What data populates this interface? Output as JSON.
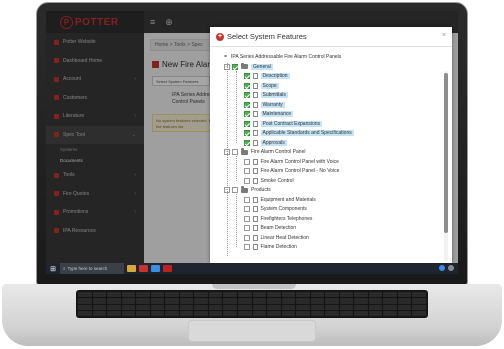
{
  "app": {
    "brand": "POTTER",
    "brand_mark": "P"
  },
  "sidebar": {
    "items": [
      {
        "label": "Potter Website"
      },
      {
        "label": "Dashboard Home"
      },
      {
        "label": "Account"
      },
      {
        "label": "Customers"
      },
      {
        "label": "Literature"
      },
      {
        "label": "Spec Tool"
      },
      {
        "label": "Tools"
      },
      {
        "label": "Fire Quotes"
      },
      {
        "label": "Promotions"
      },
      {
        "label": "IPA Resources"
      }
    ],
    "sub_items": [
      "Systems",
      "Documents"
    ]
  },
  "topbar": {
    "menu_icon": "≡",
    "globe_icon": "⊕"
  },
  "main": {
    "breadcrumb": "Home  >  Tools  >  Spec",
    "page_title": "New Fire Alarm Sp",
    "select_button": "Select System Features",
    "system_label": "IPA Series Addressable Fire Alarm Control Panels",
    "warning": "No system features selected. Please select from the features list."
  },
  "modal": {
    "title": "Select System Features",
    "close": "×",
    "root": "IPA Series Addressable Fire Alarm Control Panels",
    "groups": [
      {
        "label": "General",
        "checked": true,
        "expanded": true,
        "items": [
          {
            "label": "Description",
            "checked": true
          },
          {
            "label": "Scope",
            "checked": true
          },
          {
            "label": "Submittals",
            "checked": true
          },
          {
            "label": "Warranty",
            "checked": true
          },
          {
            "label": "Maintenance",
            "checked": true
          },
          {
            "label": "Post Contract Expansions",
            "checked": true
          },
          {
            "label": "Applicable Standards and Specifications",
            "checked": true
          },
          {
            "label": "Approvals",
            "checked": true
          }
        ]
      },
      {
        "label": "Fire Alarm Control Panel",
        "checked": false,
        "expanded": true,
        "items": [
          {
            "label": "Fire Alarm Control Panel with Voice",
            "checked": false
          },
          {
            "label": "Fire Alarm Control Panel - No Voice",
            "checked": false
          },
          {
            "label": "Smoke Control",
            "checked": false
          }
        ]
      },
      {
        "label": "Products",
        "checked": false,
        "expanded": true,
        "items": [
          {
            "label": "Equipment and Materials",
            "checked": false
          },
          {
            "label": "System Components",
            "checked": false
          },
          {
            "label": "Firefighters Telephones",
            "checked": false
          },
          {
            "label": "Beam Detection",
            "checked": false
          },
          {
            "label": "Linear Heat Detection",
            "checked": false
          },
          {
            "label": "Flame Detection",
            "checked": false
          }
        ]
      }
    ]
  },
  "taskbar": {
    "search_placeholder": "Type here to search"
  },
  "colors": {
    "brand_red": "#c8332d",
    "check_green": "#4caf50",
    "highlight_blue": "#c5e3f6",
    "sidebar_dark": "#3a3a3a"
  }
}
